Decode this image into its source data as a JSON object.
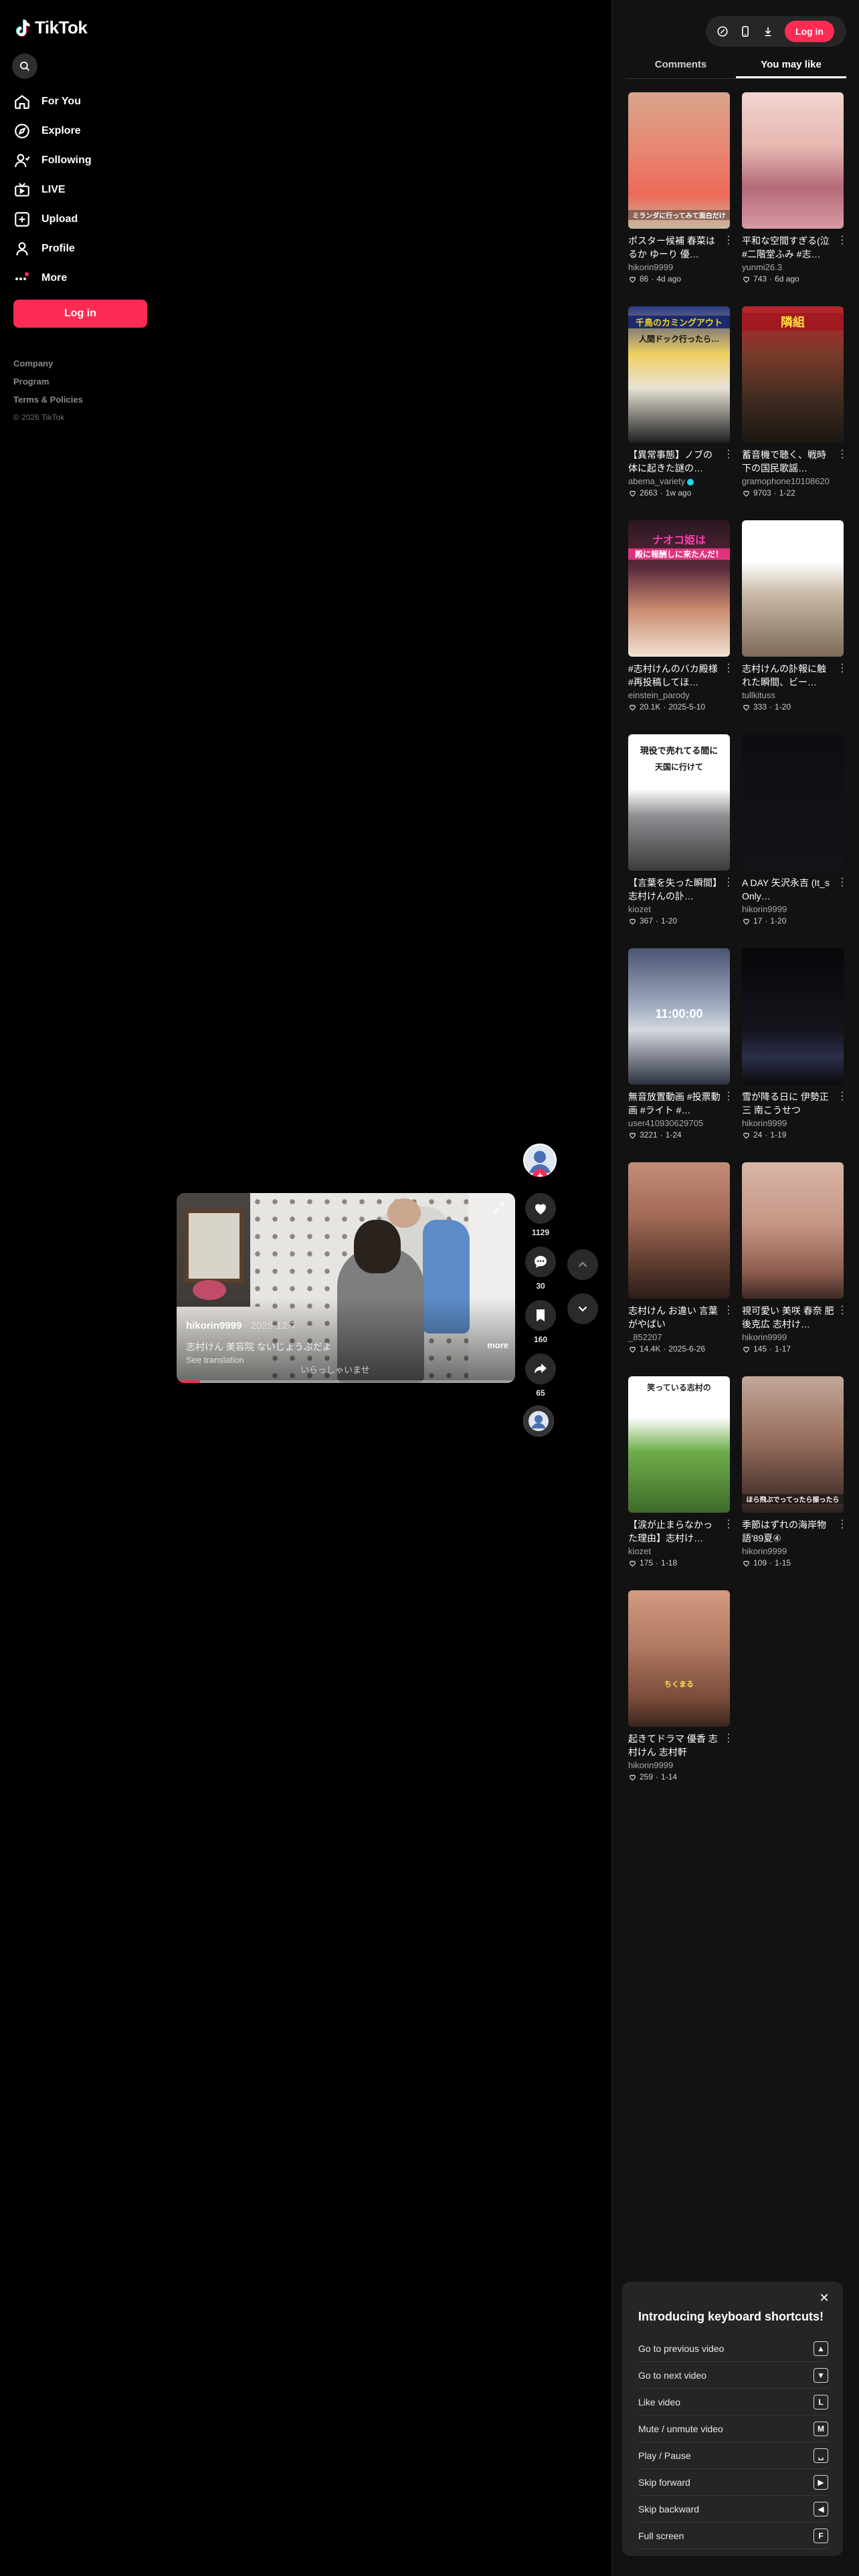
{
  "brand": {
    "name": "TikTok",
    "accent": "#fe2c55"
  },
  "sidebar": {
    "items": [
      {
        "label": "For You",
        "icon": "home-icon"
      },
      {
        "label": "Explore",
        "icon": "compass-icon"
      },
      {
        "label": "Following",
        "icon": "following-icon"
      },
      {
        "label": "LIVE",
        "icon": "live-icon"
      },
      {
        "label": "Upload",
        "icon": "upload-icon"
      },
      {
        "label": "Profile",
        "icon": "profile-icon"
      },
      {
        "label": "More",
        "icon": "more-icon"
      }
    ],
    "login_label": "Log in",
    "footer": {
      "company": "Company",
      "program": "Program",
      "terms": "Terms & Policies",
      "copyright": "© 2026 TikTok"
    }
  },
  "video": {
    "author": "hikorin9999",
    "date": "· 2025-12-7",
    "caption": "志村けん 美容院 ないじょうぶだよ",
    "see_translation": "See translation",
    "more": "more",
    "subtitle": "いらっしゃいませ",
    "progress": 0.07,
    "likes": "1129",
    "comments": "30",
    "saves": "160",
    "shares": "65"
  },
  "topbar": {
    "login_label": "Log in"
  },
  "panel_tabs": [
    {
      "label": "Comments",
      "active": false
    },
    {
      "label": "You may like",
      "active": true
    }
  ],
  "recommendations": [
    {
      "title": "ポスター候補 春菜はるか ゆーり 優…",
      "author": "hikorin9999",
      "likes": "86",
      "age": "4d ago",
      "thumb_text": "ミランダに行ってみて面白だけ"
    },
    {
      "title": "平和な空間すぎる(泣 #二階堂ふみ #志…",
      "author": "yunmi26.3",
      "likes": "743",
      "age": "6d ago",
      "thumb_text": ""
    },
    {
      "title": "【異常事態】ノブの体に起きた謎の…",
      "author": "abema_variety",
      "likes": "2663",
      "age": "1w ago",
      "thumb_text": "千鳥のカミングアウト",
      "thumb_text2": "人間ドック行ったら…",
      "verified": true
    },
    {
      "title": "蓄音機で聴く、戦時下の国民歌謡…",
      "author": "gramophone10108620",
      "likes": "9703",
      "age": "1-22",
      "thumb_text": "隣組"
    },
    {
      "title": "#志村けんのバカ殿様 #再投稿してほ…",
      "author": "einstein_parody",
      "likes": "20.1K",
      "age": "2025-5-10",
      "thumb_text": "ナオコ姫は",
      "thumb_text2": "殿に報酬しに来たんだ！"
    },
    {
      "title": "志村けんの訃報に触れた瞬間、ビー…",
      "author": "tullkituss",
      "likes": "333",
      "age": "1-20",
      "thumb_text": ""
    },
    {
      "title": "【言葉を失った瞬間】志村けんの訃…",
      "author": "kiozet",
      "likes": "367",
      "age": "1-20",
      "thumb_text": "現役で売れてる間に",
      "thumb_text2": "天国に行けて"
    },
    {
      "title": "A DAY 矢沢永吉 (It_s Only…",
      "author": "hikorin9999",
      "likes": "17",
      "age": "1-20",
      "thumb_text": ""
    },
    {
      "title": "無音放置動画 #投票動画 #ライト #…",
      "author": "user410930629705",
      "likes": "3221",
      "age": "1-24",
      "thumb_text": "11:00:00"
    },
    {
      "title": "雪が降る日に 伊勢正三 南こうせつ",
      "author": "hikorin9999",
      "likes": "24",
      "age": "1-19",
      "thumb_text": ""
    },
    {
      "title": "志村けん お違い 言葉がやばい",
      "author": "_852207",
      "likes": "14.4K",
      "age": "2025-6-26",
      "thumb_text": ""
    },
    {
      "title": "視可愛い 美咲 春奈 肥後克広 志村け…",
      "author": "hikorin9999",
      "likes": "145",
      "age": "1-17",
      "thumb_text": ""
    },
    {
      "title": "【涙が止まらなかった理由】志村け…",
      "author": "kiozet",
      "likes": "175",
      "age": "1-18",
      "thumb_text": "笑っている志村の"
    },
    {
      "title": "季節はずれの海岸物語'89夏④",
      "author": "hikorin9999",
      "likes": "109",
      "age": "1-15",
      "thumb_text": "ほら飛ぶでってったら振ったら"
    },
    {
      "title": "起きてドラマ 優香 志村けん 志村軒",
      "author": "hikorin9999",
      "likes": "259",
      "age": "1-14",
      "thumb_text": "ちくまる"
    }
  ],
  "shortcuts": {
    "title": "Introducing keyboard shortcuts!",
    "items": [
      {
        "label": "Go to previous video",
        "key": "▲"
      },
      {
        "label": "Go to next video",
        "key": "▼"
      },
      {
        "label": "Like video",
        "key": "L"
      },
      {
        "label": "Mute / unmute video",
        "key": "M"
      },
      {
        "label": "Play / Pause",
        "key": "␣"
      },
      {
        "label": "Skip forward",
        "key": "▶"
      },
      {
        "label": "Skip backward",
        "key": "◀"
      },
      {
        "label": "Full screen",
        "key": "F"
      }
    ]
  }
}
